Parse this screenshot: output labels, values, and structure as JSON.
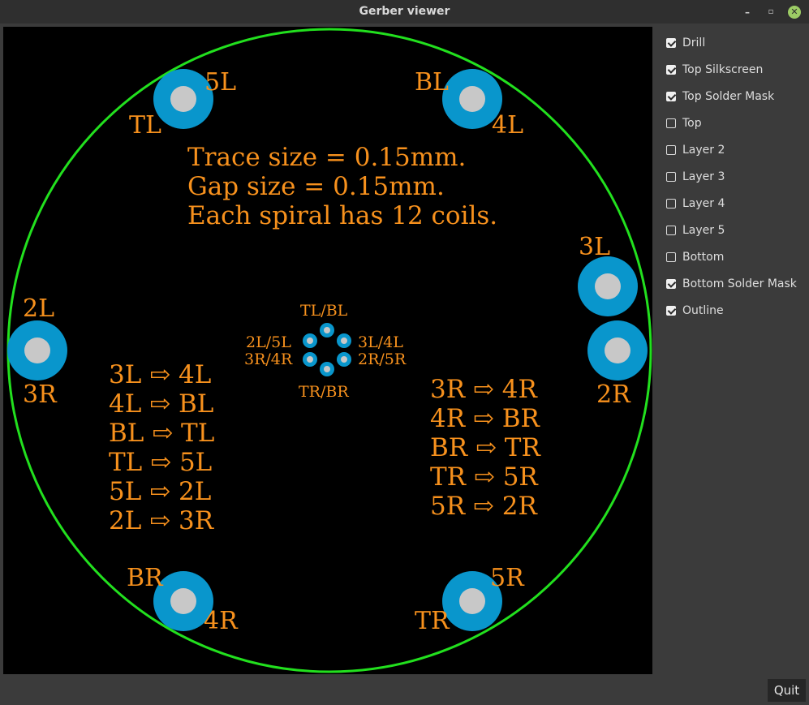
{
  "window": {
    "title": "Gerber viewer",
    "controls": {
      "minimize": "–",
      "maximize": "▫",
      "close": "✕"
    }
  },
  "layers": [
    {
      "label": "Drill",
      "checked": true
    },
    {
      "label": "Top Silkscreen",
      "checked": true
    },
    {
      "label": "Top Solder Mask",
      "checked": true
    },
    {
      "label": "Top",
      "checked": false
    },
    {
      "label": "Layer 2",
      "checked": false
    },
    {
      "label": "Layer 3",
      "checked": false
    },
    {
      "label": "Layer 4",
      "checked": false
    },
    {
      "label": "Layer 5",
      "checked": false
    },
    {
      "label": "Bottom",
      "checked": false
    },
    {
      "label": "Bottom Solder Mask",
      "checked": true
    },
    {
      "label": "Outline",
      "checked": true
    }
  ],
  "quit_label": "Quit",
  "colors": {
    "outline": "#22e01e",
    "pad": "#0996cc",
    "drill": "#c8c8c8",
    "silkscreen": "#f7911d",
    "background": "#000000"
  },
  "pcb": {
    "info_lines": [
      "Trace size = 0.15mm.",
      "Gap size = 0.15mm.",
      "Each spiral has 12 coils."
    ],
    "pad_labels": {
      "tl_top": "5L",
      "tl_bottom": "TL",
      "tr_top": "BL",
      "tr_bottom": "4L",
      "r_top": "3L",
      "r_bottom": "2R",
      "l_top": "2L",
      "l_bottom": "3R",
      "bl_top": "BR",
      "bl_bottom": "4R",
      "br_top": "5R",
      "br_bottom": "TR"
    },
    "via_labels": {
      "top": "TL/BL",
      "left_top": "2L/5L",
      "left_bottom": "3R/4R",
      "right_top": "3L/4L",
      "right_bottom": "2R/5R",
      "bottom": "TR/BR"
    },
    "left_routes": [
      "3L ⇨ 4L",
      "4L ⇨ BL",
      "BL ⇨ TL",
      "TL ⇨ 5L",
      "5L ⇨ 2L",
      "2L ⇨ 3R"
    ],
    "right_routes": [
      "3R ⇨ 4R",
      "4R ⇨ BR",
      "BR ⇨ TR",
      "TR ⇨ 5R",
      "5R ⇨ 2R"
    ]
  }
}
